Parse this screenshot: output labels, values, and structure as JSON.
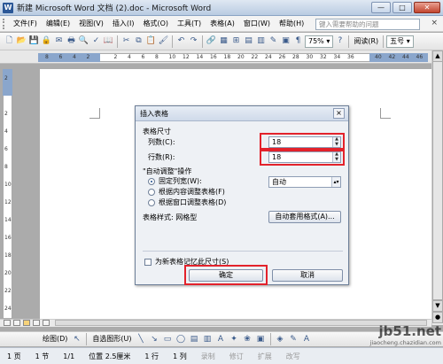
{
  "window": {
    "title": "新建 Microsoft Word 文档 (2).doc - Microsoft Word",
    "minimize": "—",
    "maximize": "□",
    "close": "✕"
  },
  "menu": {
    "items": [
      "文件(F)",
      "编辑(E)",
      "视图(V)",
      "插入(I)",
      "格式(O)",
      "工具(T)",
      "表格(A)",
      "窗口(W)",
      "帮助(H)"
    ],
    "help_placeholder": "键入需要帮助的问题",
    "close": "×"
  },
  "toolbar": {
    "zoom": "75%",
    "reading": "阅读(R)",
    "font_size": "五号"
  },
  "ruler": {
    "ticks": [
      "8",
      "6",
      "4",
      "2",
      "",
      "2",
      "4",
      "6",
      "8",
      "10",
      "12",
      "14",
      "16",
      "18",
      "20",
      "22",
      "24",
      "26",
      "28",
      "30",
      "32",
      "34",
      "36",
      "",
      "40",
      "42",
      "44",
      "46"
    ]
  },
  "vruler": {
    "ticks": [
      "2",
      "",
      "2",
      "4",
      "6",
      "8",
      "10",
      "12",
      "14",
      "16",
      "18",
      "20",
      "22",
      "24"
    ]
  },
  "dialog": {
    "title": "插入表格",
    "close": "×",
    "size_group": "表格尺寸",
    "columns_label": "列数(C):",
    "columns_value": "18",
    "rows_label": "行数(R):",
    "rows_value": "18",
    "autofit_group": "\"自动调整\"操作",
    "fixed_width_label": "固定列宽(W):",
    "fixed_width_value": "自动",
    "fit_content_label": "根据内容调整表格(F)",
    "fit_window_label": "根据窗口调整表格(D)",
    "style_label": "表格样式: 网格型",
    "autoformat_button": "自动套用格式(A)...",
    "remember_label": "为新表格记忆此尺寸(S)",
    "ok_button": "确定",
    "cancel_button": "取消"
  },
  "drawbar": {
    "draw": "绘图(D)",
    "autoshapes": "自选图形(U)"
  },
  "status": {
    "page": "1 页",
    "section": "1 节",
    "pages": "1/1",
    "position": "位置 2.5厘米",
    "line": "1 行",
    "column": "1 列",
    "rec": "录制",
    "trk": "修订",
    "ext": "扩展",
    "ovr": "改写"
  },
  "watermark": {
    "brand": "jb51.net",
    "sub": "jiaocheng.chazidian.com"
  },
  "colors": {
    "highlight": "#e3222b",
    "accent": "#2b5797"
  }
}
